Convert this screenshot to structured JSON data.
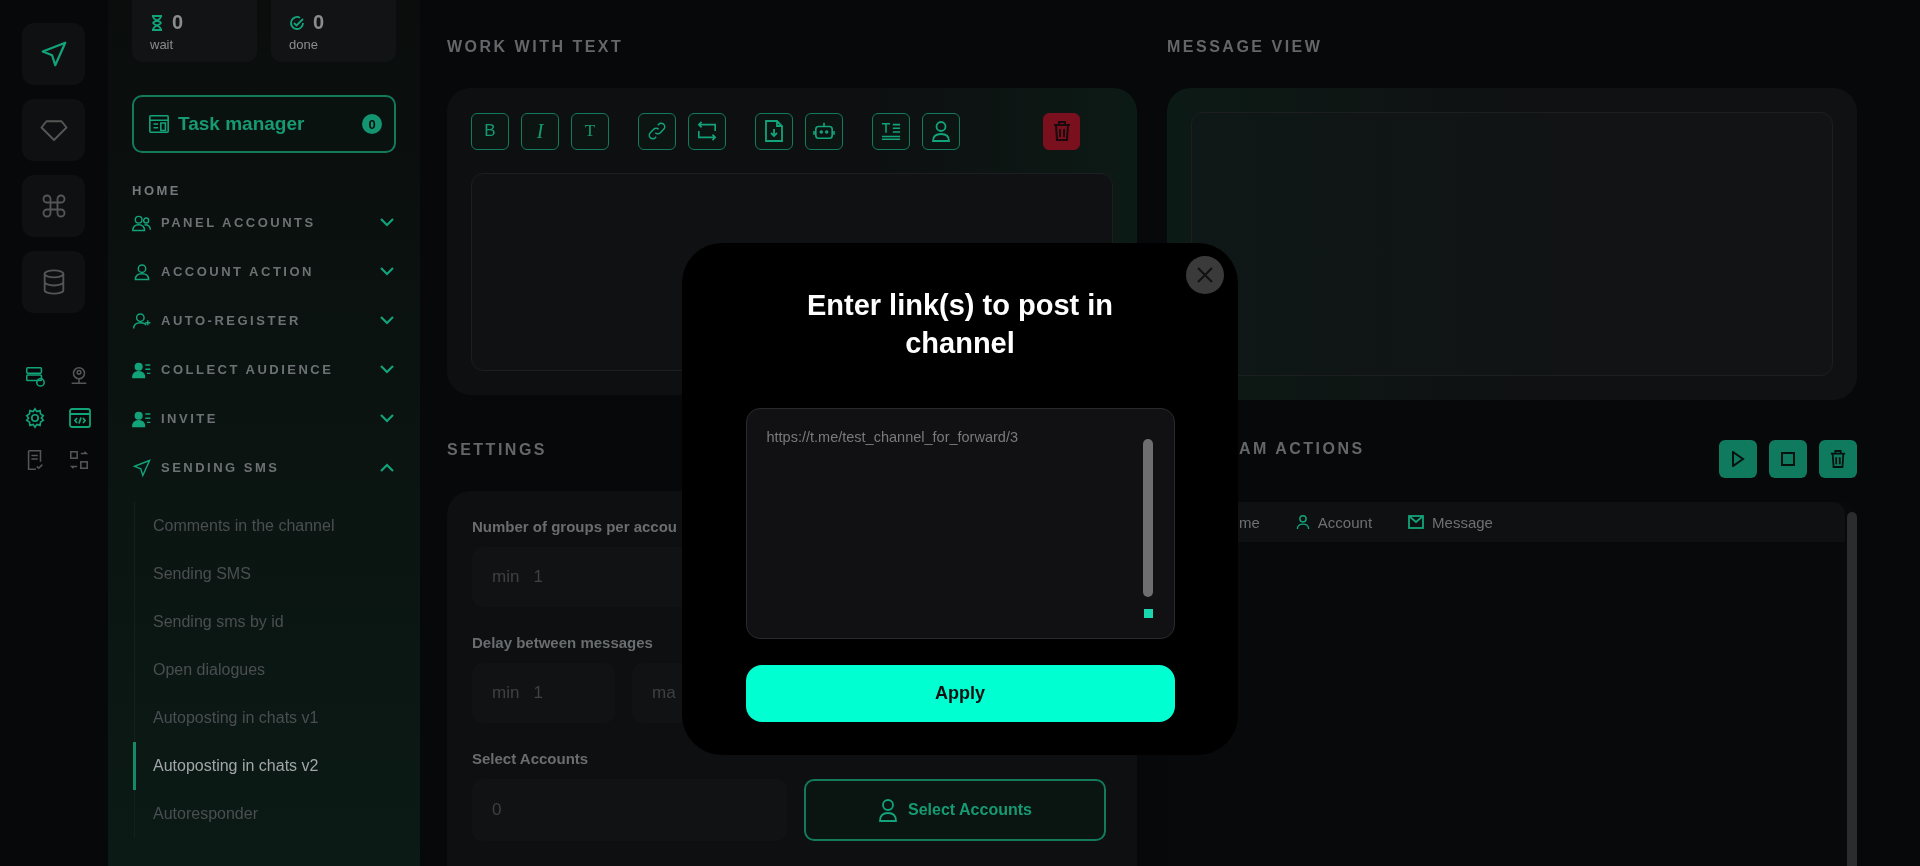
{
  "counters": [
    {
      "value": "0",
      "label": "wait"
    },
    {
      "value": "0",
      "label": "done"
    }
  ],
  "task_manager": {
    "label": "Task manager",
    "badge": "0"
  },
  "home": "HOME",
  "nav": [
    {
      "label": "PANEL ACCOUNTS",
      "expanded": false
    },
    {
      "label": "ACCOUNT ACTION",
      "expanded": false
    },
    {
      "label": "AUTO-REGISTER",
      "expanded": false
    },
    {
      "label": "COLLECT AUDIENCE",
      "expanded": false
    },
    {
      "label": "INVITE",
      "expanded": false
    },
    {
      "label": "SENDING SMS",
      "expanded": true,
      "children": [
        {
          "label": "Comments in the channel",
          "selected": false
        },
        {
          "label": "Sending SMS",
          "selected": false
        },
        {
          "label": "Sending sms by id",
          "selected": false
        },
        {
          "label": "Open dialogues",
          "selected": false
        },
        {
          "label": "Autoposting in chats v1",
          "selected": false
        },
        {
          "label": "Autoposting in chats v2",
          "selected": true
        },
        {
          "label": "Autoresponder",
          "selected": false
        }
      ]
    }
  ],
  "work_with_text": {
    "title": "WORK WITH TEXT",
    "format_buttons": [
      "B",
      "I",
      "T"
    ]
  },
  "message_view": {
    "title": "MESSAGE VIEW"
  },
  "settings": {
    "title": "SETTINGS",
    "groups": {
      "label": "Number of groups per accou",
      "fields": [
        {
          "prefix": "min",
          "value": "1"
        }
      ]
    },
    "delay": {
      "label": "Delay between messages",
      "fields": [
        {
          "prefix": "min",
          "value": "1"
        },
        {
          "prefix": "ma"
        }
      ]
    },
    "accounts": {
      "label": "Select Accounts",
      "value": "0",
      "button": "Select Accounts"
    }
  },
  "actions": {
    "title": "AM ACTIONS",
    "columns": [
      "me",
      "Account",
      "Message"
    ]
  },
  "dialog": {
    "title": "Enter link(s) to post in channel",
    "value": "https://t.me/test_channel_for_forward/3",
    "button": "Apply"
  }
}
